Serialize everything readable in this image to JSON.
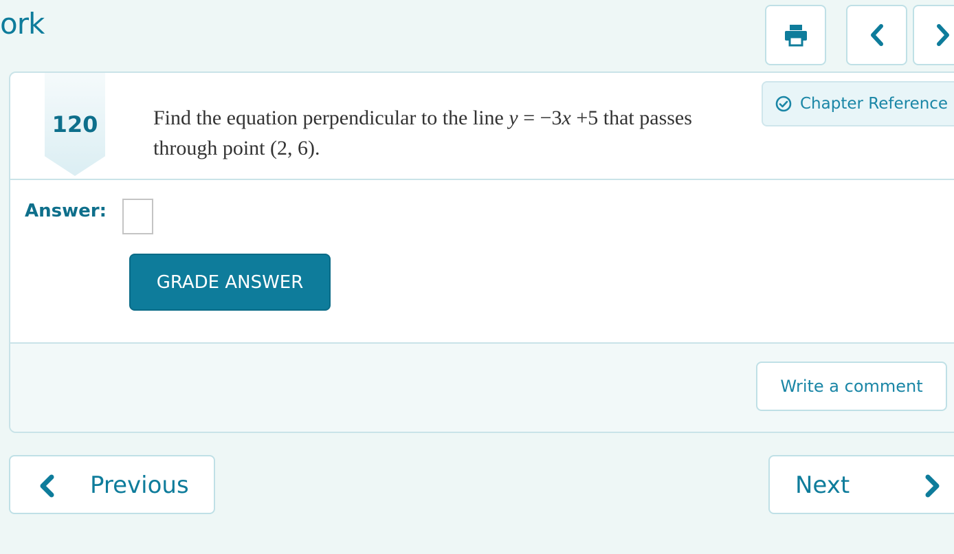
{
  "header": {
    "title_fragment": "ork"
  },
  "toolbar": {
    "print_icon": "printer-icon",
    "prev_icon": "chevron-left-icon",
    "next_icon": "chevron-right-icon"
  },
  "problem": {
    "number": "120",
    "text_part1": "Find the equation perpendicular to the line ",
    "equation_y": "y",
    "equation_eq": " = −3",
    "equation_x": "x",
    "equation_rest": " +5",
    "text_part2": " that passes through point (2, 6).",
    "chapter_reference_label": "Chapter Reference"
  },
  "answer": {
    "label": "Answer:",
    "value": "",
    "grade_button_label": "GRADE ANSWER"
  },
  "comments": {
    "write_comment_label": "Write a comment"
  },
  "navigation": {
    "previous_label": "Previous",
    "next_label": "Next"
  },
  "colors": {
    "accent": "#0e7c9b",
    "background": "#eef7f6",
    "border": "#c9e3e8"
  }
}
